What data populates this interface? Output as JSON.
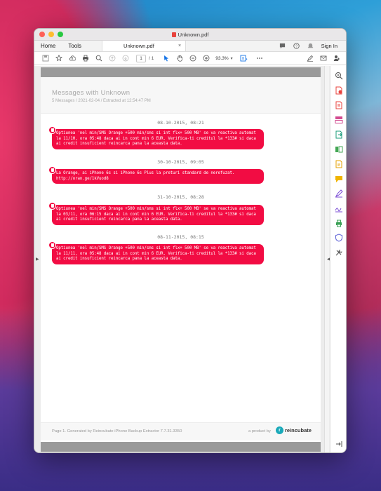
{
  "window": {
    "title": "Unknown.pdf"
  },
  "tabbar": {
    "home_label": "Home",
    "tools_label": "Tools",
    "doc_tab_label": "Unknown.pdf",
    "close_glyph": "×",
    "sign_in_label": "Sign In",
    "icons": [
      "chat-icon",
      "help-icon",
      "bell-icon"
    ]
  },
  "toolbar": {
    "page_current": "1",
    "page_total": "/ 1",
    "zoom": "93.3%",
    "icons": [
      "save-icon",
      "bookmark-star-icon",
      "upload-icon",
      "print-icon",
      "zoom-search-icon",
      "prev-page-icon",
      "next-page-icon",
      "cursor-icon",
      "hand-icon",
      "zoom-out-icon",
      "zoom-in-icon",
      "fit-page-icon",
      "more-icon",
      "sign-icon",
      "mail-icon",
      "share-user-icon"
    ]
  },
  "document": {
    "title": "Messages with Unknown",
    "subtitle": "5 Messages / 2021-02-04 / Extracted at 12:54:47 PM",
    "messages": [
      {
        "date": "08-10-2015, 08:21",
        "text": "Optiunea 'nel min/SMS Orange +500 min/sms si int flx+ 500 MB' se va reactiva automat la 11/10, ora 05:48 daca ai in cont min 6 EUR. Verifica-ti creditul la *133# si daca ai credit insuficient reincarca pana la aceasta data."
      },
      {
        "date": "30-10-2015, 09:05",
        "text": "La Orange, ai iPhone 6s si iPhone 6s Plus la preturi standard de nerefuzat. http://oran.ge/1kVuod8"
      },
      {
        "date": "31-10-2015, 08:28",
        "text": "Optiunea 'nel min/SMS Orange +500 min/sms si int flx+ 500 MB' se va reactiva automat la 03/11, ora 06:15 daca ai in cont min 6 EUR. Verifica-ti creditul la *133# si daca ai credit insuficient reincarca pana la aceasta data."
      },
      {
        "date": "08-11-2015, 08:15",
        "text": "Optiunea 'nel min/SMS Orange +500 min/sms si int flx+ 500 MB' se va reactiva automat la 11/11, ora 05:48 daca ai in cont min 6 EUR. Verifica-ti creditul la *133# si daca ai credit insuficient reincarca pana la aceasta data."
      }
    ],
    "footer_left": "Page 1. Generated by Reincubate iPhone Backup Extractor 7.7.31.3350",
    "footer_right": "a product by",
    "brand": "reincubate"
  },
  "colors": {
    "bubble": "#f20c43",
    "accent": "#1473e6"
  }
}
